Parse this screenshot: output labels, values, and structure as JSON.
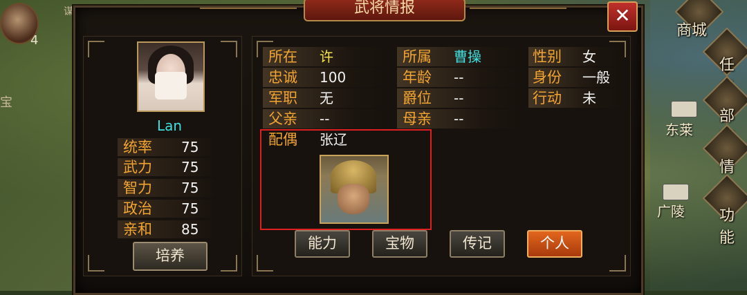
{
  "hud": {
    "count": "4",
    "frag_top": "谋",
    "frag_left": "宝"
  },
  "side_menu": {
    "items": [
      {
        "label": "商城"
      },
      {
        "label": "任务"
      },
      {
        "label": "部下"
      },
      {
        "label": "情报"
      },
      {
        "label": "功能"
      }
    ],
    "cities": [
      {
        "label": "东莱"
      },
      {
        "label": "广陵"
      }
    ]
  },
  "dialog": {
    "title": "武将情报",
    "close_label": "✕"
  },
  "general": {
    "name": "Lan",
    "stats": [
      {
        "label": "统率",
        "value": "75"
      },
      {
        "label": "武力",
        "value": "75"
      },
      {
        "label": "智力",
        "value": "75"
      },
      {
        "label": "政治",
        "value": "75"
      },
      {
        "label": "亲和",
        "value": "85"
      }
    ],
    "train_label": "培养"
  },
  "info": {
    "location_label": "所在",
    "location_value": "许",
    "faction_label": "所属",
    "faction_value": "曹操",
    "gender_label": "性别",
    "gender_value": "女",
    "loyalty_label": "忠诚",
    "loyalty_value": "100",
    "age_label": "年龄",
    "age_value": "--",
    "status_label": "身份",
    "status_value": "一般",
    "post_label": "军职",
    "post_value": "无",
    "rank_label": "爵位",
    "rank_value": "--",
    "action_label": "行动",
    "action_value": "未",
    "father_label": "父亲",
    "father_value": "--",
    "mother_label": "母亲",
    "mother_value": "--",
    "spouse_label": "配偶",
    "spouse_value": "张辽"
  },
  "tabs": [
    {
      "label": "能力"
    },
    {
      "label": "宝物"
    },
    {
      "label": "传记"
    },
    {
      "label": "个人",
      "active": true
    }
  ],
  "colors": {
    "label_orange": "#f3a531",
    "cyan": "#3fe0e0",
    "yellow": "#f4e44a",
    "highlight_red": "#e02020"
  }
}
